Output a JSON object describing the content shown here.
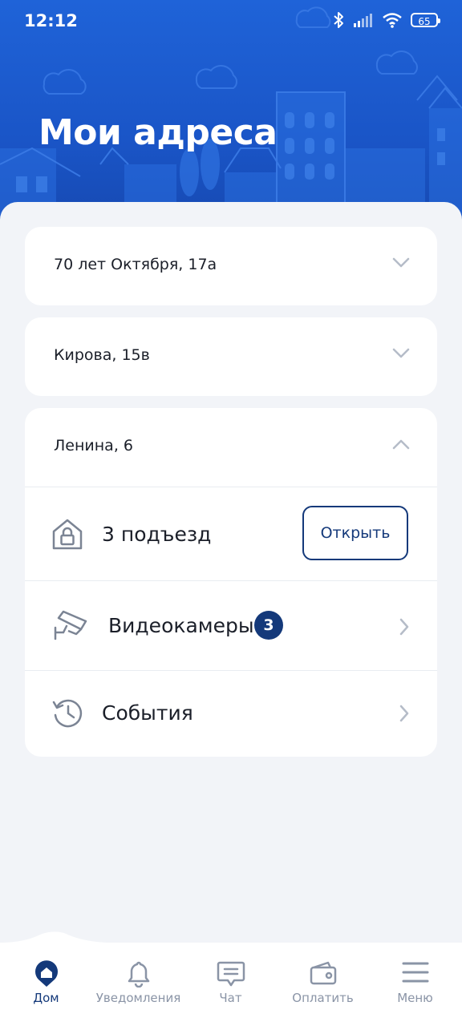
{
  "status_bar": {
    "time": "12:12",
    "battery": "65",
    "icons": [
      "bluetooth-icon",
      "signal-icon",
      "wifi-icon",
      "battery-icon"
    ]
  },
  "header": {
    "title": "Мои адреса"
  },
  "addresses": [
    {
      "label": "70 лет Октября, 17а",
      "expanded": false
    },
    {
      "label": "Кирова, 15в",
      "expanded": false
    },
    {
      "label": "Ленина, 6",
      "expanded": true
    }
  ],
  "expanded_address": {
    "entrance": {
      "label": "3 подъезд",
      "button": "Открыть",
      "icon": "lock-house-icon"
    },
    "cameras": {
      "label": "Видеокамеры",
      "count": "3",
      "icon": "camera-icon"
    },
    "events": {
      "label": "События",
      "icon": "history-icon"
    }
  },
  "bottom_nav": [
    {
      "label": "Дом",
      "icon": "home-icon",
      "active": true
    },
    {
      "label": "Уведомления",
      "icon": "bell-icon",
      "active": false
    },
    {
      "label": "Чат",
      "icon": "chat-icon",
      "active": false
    },
    {
      "label": "Оплатить",
      "icon": "wallet-icon",
      "active": false
    },
    {
      "label": "Меню",
      "icon": "menu-icon",
      "active": false
    }
  ],
  "colors": {
    "header_bg": "#1f63d8",
    "accent": "#14397a",
    "page_bg": "#f2f4f8",
    "card_bg": "#ffffff",
    "muted": "#8a94a6"
  }
}
